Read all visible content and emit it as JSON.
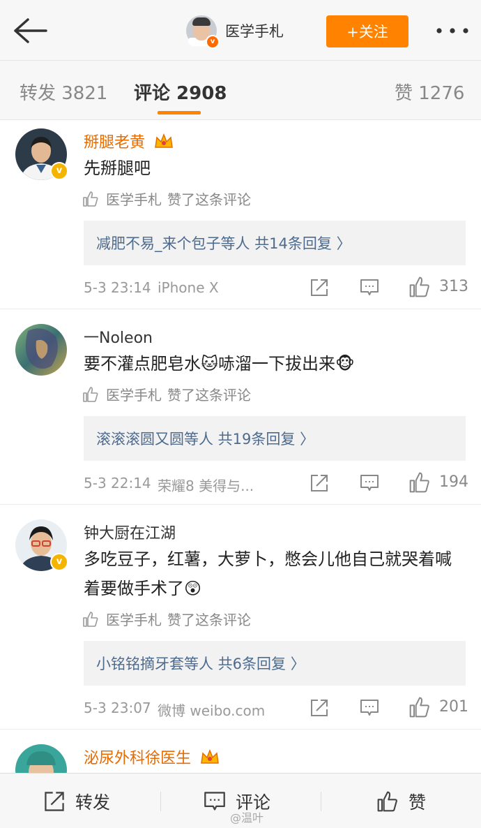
{
  "header": {
    "author_name": "医学手札",
    "follow_label": "+关注",
    "back_icon": "back-arrow-icon",
    "more_icon": "more-dots-icon"
  },
  "tabs": [
    {
      "label": "转发 3821"
    },
    {
      "label": "评论 2908"
    },
    {
      "label": "赞 1276"
    }
  ],
  "comments": [
    {
      "user": "掰腿老黄",
      "text": "先掰腿吧",
      "liked_by": "医学手札",
      "liked_suffix": "赞了这条评论",
      "replies": "减肥不易_来个包子等人  共14条回复 〉",
      "time": "5-3 23:14",
      "source": "iPhone X",
      "likes": "313"
    },
    {
      "user": "一Noleon",
      "text": "要不灌点肥皂水🐱哧溜一下拔出来🐵",
      "liked_by": "医学手札",
      "liked_suffix": "赞了这条评论",
      "replies": "滚滚滚圆又圆等人  共19条回复 〉",
      "time": "5-3 22:14",
      "source": "荣耀8 美得与...",
      "likes": "194"
    },
    {
      "user": "钟大厨在江湖",
      "text": "多吃豆子，红薯，大萝卜，憋会儿他自己就哭着喊着要做手术了😲",
      "liked_by": "医学手札",
      "liked_suffix": "赞了这条评论",
      "replies": "小铭铭摘牙套等人  共6条回复 〉",
      "time": "5-3 23:07",
      "source": "微博 weibo.com",
      "likes": "201"
    },
    {
      "user": "泌尿外科徐医生"
    }
  ],
  "bottom": {
    "repost_label": "转发",
    "comment_label": "评论",
    "like_label": "赞"
  },
  "watermark": "@温叶",
  "colors": {
    "accent": "#ff8200",
    "vip_name": "#e86b00",
    "link": "#4e6b8d"
  }
}
